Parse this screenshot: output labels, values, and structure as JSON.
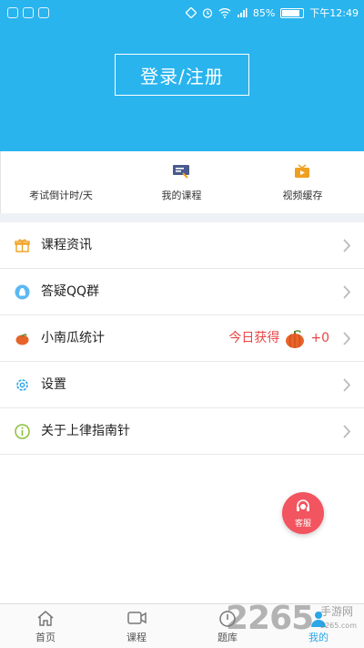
{
  "status_bar": {
    "battery": "85%",
    "time": "下午12:49",
    "battery_level": 0.85
  },
  "header": {
    "login_label": "登录/注册"
  },
  "quick_links": [
    {
      "label": "考试倒计时/天",
      "icon": "countdown"
    },
    {
      "label": "我的课程",
      "icon": "course-board-icon"
    },
    {
      "label": "视频缓存",
      "icon": "video-cache-icon"
    }
  ],
  "menu": [
    {
      "label": "课程资讯",
      "icon": "gift-icon"
    },
    {
      "label": "答疑QQ群",
      "icon": "qq-icon"
    },
    {
      "label": "小南瓜统计",
      "icon": "pumpkin-icon",
      "today_label": "今日获得",
      "today_value": "+0"
    },
    {
      "label": "设置",
      "icon": "gear-icon"
    },
    {
      "label": "关于上律指南针",
      "icon": "info-icon"
    }
  ],
  "fab": {
    "label": "客服"
  },
  "tabs": [
    {
      "label": "首页",
      "icon": "home-icon"
    },
    {
      "label": "课程",
      "icon": "video-camera-icon"
    },
    {
      "label": "题库",
      "icon": "clock-icon"
    },
    {
      "label": "我的",
      "icon": "user-icon",
      "active": true
    }
  ],
  "watermark": {
    "number": "2265",
    "site": "手游网",
    "url": "2265.com"
  },
  "colors": {
    "accent": "#29b4ee",
    "alert": "#e84545",
    "fab": "#f2555f"
  }
}
